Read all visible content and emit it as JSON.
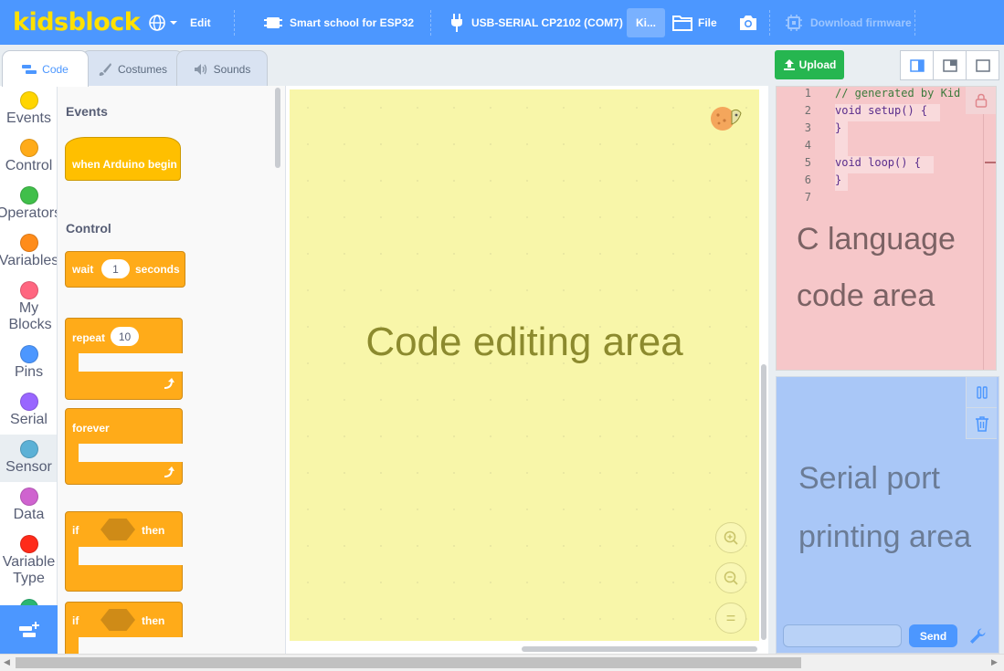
{
  "menubar": {
    "logo": "kidsblock",
    "edit_label": "Edit",
    "device_label": "Smart school for ESP32",
    "port_label": "USB-SERIAL CP2102 (COM7)",
    "kid_label": "Ki...",
    "file_label": "File",
    "firmware_label": "Download firmware",
    "accent_color": "#4c97ff",
    "logo_color": "#ffe100"
  },
  "tabs": [
    {
      "label": "Code",
      "icon": "code-icon"
    },
    {
      "label": "Costumes",
      "icon": "brush-icon"
    },
    {
      "label": "Sounds",
      "icon": "speaker-icon"
    }
  ],
  "categories": [
    {
      "label": "Events",
      "color": "#ffd500"
    },
    {
      "label": "Control",
      "color": "#ffab19"
    },
    {
      "label": "Operators",
      "color": "#40bf4a"
    },
    {
      "label": "Variables",
      "color": "#ff8c1a"
    },
    {
      "label": "My Blocks",
      "color": "#ff6680"
    },
    {
      "label": "Pins",
      "color": "#4c97ff"
    },
    {
      "label": "Serial",
      "color": "#9966ff"
    },
    {
      "label": "Sensor",
      "color": "#5cb1d6"
    },
    {
      "label": "Data",
      "color": "#cf63cf"
    },
    {
      "label": "Variable Type",
      "color": "#ff2b1a"
    }
  ],
  "palette": {
    "events_heading": "Events",
    "control_heading": "Control",
    "when_arduino_begin": "when Arduino begin",
    "wait_label": "wait",
    "wait_value": "1",
    "seconds_label": "seconds",
    "repeat_label": "repeat",
    "repeat_value": "10",
    "forever_label": "forever",
    "if_label": "if",
    "then_label": "then"
  },
  "workspace": {
    "overlay_label": "Code editing area",
    "zoom_in": "+",
    "zoom_out": "−",
    "zoom_reset": "="
  },
  "toolbar": {
    "upload_label": "Upload"
  },
  "code_panel": {
    "lines": [
      {
        "num": "1",
        "text": "// generated by Kid"
      },
      {
        "num": "2",
        "text": "void setup() {"
      },
      {
        "num": "3",
        "text": "}"
      },
      {
        "num": "4",
        "text": ""
      },
      {
        "num": "5",
        "text": "void loop() {"
      },
      {
        "num": "6",
        "text": "}"
      },
      {
        "num": "7",
        "text": ""
      }
    ],
    "overlay_line1": "C language",
    "overlay_line2": "code area"
  },
  "serial_panel": {
    "overlay_line1": "Serial port",
    "overlay_line2": "printing area",
    "input_value": "",
    "send_label": "Send"
  }
}
